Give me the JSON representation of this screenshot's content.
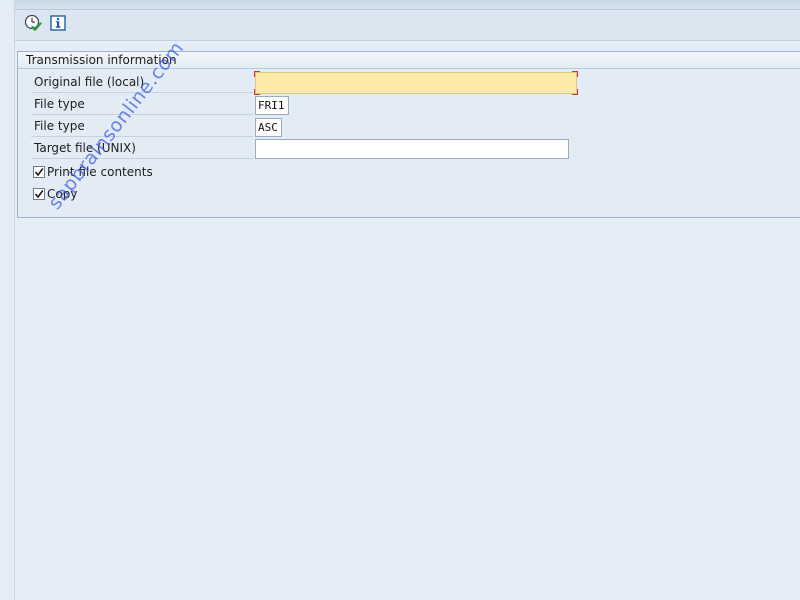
{
  "toolbar": {
    "execute_icon": "execute-clock-check-icon",
    "info_icon": "information-icon"
  },
  "group": {
    "title": "Transmission information"
  },
  "fields": {
    "original_file_label": "Original file (local)",
    "original_file_value": "",
    "file_type_1_label": "File type",
    "file_type_1_value": "FRI1",
    "file_type_2_label": "File type",
    "file_type_2_value": "ASC",
    "target_file_label": "Target file (UNIX)",
    "target_file_value": ""
  },
  "checkboxes": {
    "print_label": "Print file contents",
    "print_checked": true,
    "copy_label": "Copy",
    "copy_checked": true
  },
  "watermark": "sapbrainsonline.com",
  "colors": {
    "background": "#e4edf5",
    "required_field": "#fde9a8",
    "required_marker": "#c0392b",
    "watermark": "#3c5ae6"
  }
}
